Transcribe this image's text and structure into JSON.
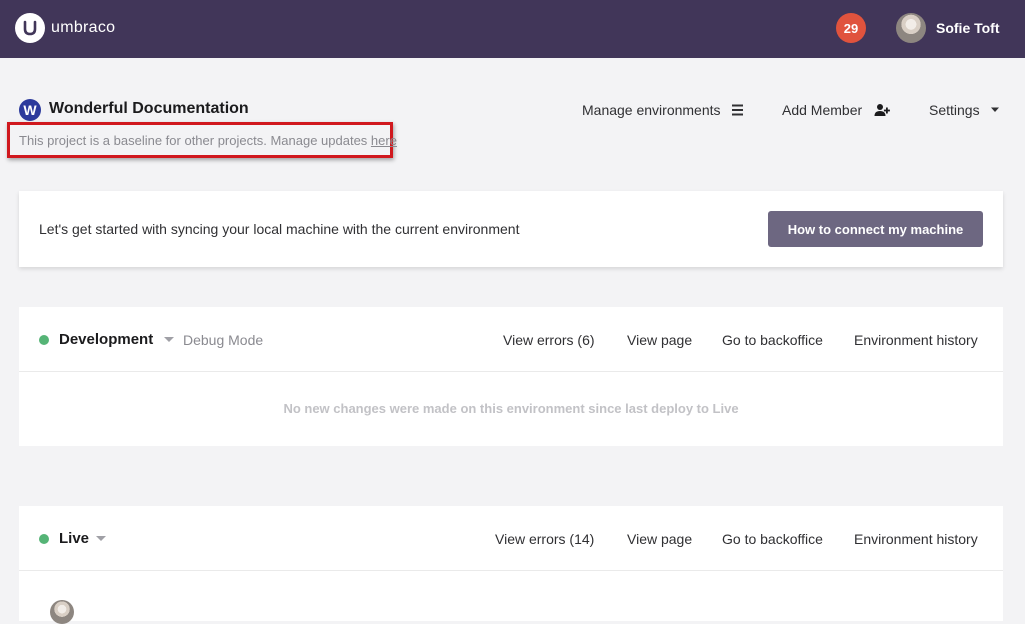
{
  "topbar": {
    "brand": "umbraco",
    "notifications_count": "29",
    "user_name": "Sofie Toft"
  },
  "project": {
    "badge_letter": "W",
    "title": "Wonderful Documentation",
    "description": "This project is a baseline for other projects. Manage updates ",
    "description_link": "here",
    "nav": {
      "manage_environments": "Manage environments",
      "add_member": "Add Member",
      "settings": "Settings"
    }
  },
  "sync": {
    "text": "Let's get started with syncing your local machine with the current environment",
    "button": "How to connect my machine"
  },
  "environments": [
    {
      "name": "Development",
      "mode": "Debug Mode",
      "status_color": "#55b476",
      "view_errors": "View errors (6)",
      "view_page": "View page",
      "backoffice": "Go to backoffice",
      "history": "Environment history",
      "empty_message": "No new changes were made on this environment since last deploy to Live"
    },
    {
      "name": "Live",
      "status_color": "#55b476",
      "view_errors": "View errors (14)",
      "view_page": "View page",
      "backoffice": "Go to backoffice",
      "history": "Environment history"
    }
  ],
  "colors": {
    "topbar": "#413659",
    "accent_button": "#6d6781",
    "notification": "#e0533d",
    "highlight_border": "#d0181e"
  }
}
